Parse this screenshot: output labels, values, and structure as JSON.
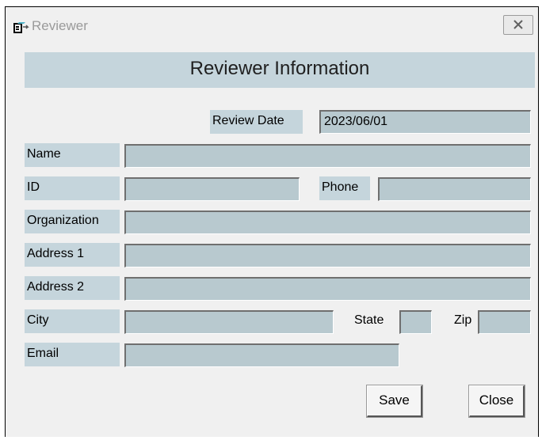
{
  "window": {
    "title": "Reviewer",
    "icon": "app-window-icon",
    "close_label": "X"
  },
  "header": {
    "title": "Reviewer Information"
  },
  "form": {
    "review_date": {
      "label": "Review Date",
      "value": "2023/06/01"
    },
    "name": {
      "label": "Name",
      "value": ""
    },
    "id": {
      "label": "ID",
      "value": ""
    },
    "phone": {
      "label": "Phone",
      "value": ""
    },
    "organization": {
      "label": "Organization",
      "value": ""
    },
    "address1": {
      "label": "Address 1",
      "value": ""
    },
    "address2": {
      "label": "Address 2",
      "value": ""
    },
    "city": {
      "label": "City",
      "value": ""
    },
    "state": {
      "label": "State",
      "value": ""
    },
    "zip": {
      "label": "Zip",
      "value": ""
    },
    "email": {
      "label": "Email",
      "value": ""
    }
  },
  "buttons": {
    "save": "Save",
    "close": "Close"
  },
  "colors": {
    "label_bg": "#c5d5dc",
    "field_bg": "#b8c9cf",
    "window_bg": "#f0f0f0"
  }
}
